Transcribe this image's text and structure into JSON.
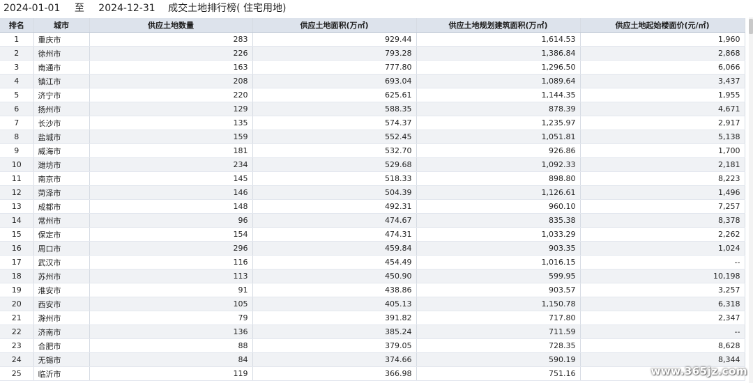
{
  "title": {
    "start_date": "2024-01-01",
    "to_label": "至",
    "end_date": "2024-12-31",
    "report_name": "成交土地排行榜( 住宅用地)"
  },
  "table": {
    "headers": [
      "排名",
      "城市",
      "供应土地数量",
      "供应土地面积(万㎡)",
      "供应土地规划建筑面积(万㎡)",
      "供应土地起始楼面价(元/㎡)"
    ],
    "rows": [
      [
        "1",
        "重庆市",
        "283",
        "929.44",
        "1,614.53",
        "1,960"
      ],
      [
        "2",
        "徐州市",
        "226",
        "793.28",
        "1,386.84",
        "2,868"
      ],
      [
        "3",
        "南通市",
        "163",
        "777.80",
        "1,296.50",
        "6,066"
      ],
      [
        "4",
        "镇江市",
        "208",
        "693.04",
        "1,089.64",
        "3,437"
      ],
      [
        "5",
        "济宁市",
        "220",
        "625.61",
        "1,144.35",
        "1,955"
      ],
      [
        "6",
        "扬州市",
        "129",
        "588.35",
        "878.39",
        "4,671"
      ],
      [
        "7",
        "长沙市",
        "135",
        "574.37",
        "1,235.97",
        "2,917"
      ],
      [
        "8",
        "盐城市",
        "159",
        "552.45",
        "1,051.81",
        "5,138"
      ],
      [
        "9",
        "威海市",
        "181",
        "532.70",
        "926.86",
        "1,700"
      ],
      [
        "10",
        "潍坊市",
        "234",
        "529.68",
        "1,092.33",
        "2,181"
      ],
      [
        "11",
        "南京市",
        "145",
        "518.33",
        "898.80",
        "8,223"
      ],
      [
        "12",
        "菏泽市",
        "146",
        "504.39",
        "1,126.61",
        "1,496"
      ],
      [
        "13",
        "成都市",
        "148",
        "492.31",
        "960.10",
        "7,257"
      ],
      [
        "14",
        "常州市",
        "96",
        "474.67",
        "835.38",
        "8,378"
      ],
      [
        "15",
        "保定市",
        "154",
        "474.31",
        "1,033.29",
        "2,262"
      ],
      [
        "16",
        "周口市",
        "296",
        "459.84",
        "903.35",
        "1,024"
      ],
      [
        "17",
        "武汉市",
        "116",
        "454.49",
        "1,016.15",
        "--"
      ],
      [
        "18",
        "苏州市",
        "113",
        "450.90",
        "599.95",
        "10,198"
      ],
      [
        "19",
        "淮安市",
        "91",
        "438.86",
        "903.57",
        "3,257"
      ],
      [
        "20",
        "西安市",
        "105",
        "405.13",
        "1,150.78",
        "6,318"
      ],
      [
        "21",
        "滁州市",
        "79",
        "391.82",
        "717.80",
        "2,347"
      ],
      [
        "22",
        "济南市",
        "136",
        "385.24",
        "711.59",
        "--"
      ],
      [
        "23",
        "合肥市",
        "88",
        "379.05",
        "728.35",
        "8,628"
      ],
      [
        "24",
        "无锡市",
        "84",
        "374.66",
        "590.19",
        "8,344"
      ],
      [
        "25",
        "临沂市",
        "119",
        "366.98",
        "751.16",
        ""
      ]
    ]
  },
  "watermark": "www.365jz.com"
}
